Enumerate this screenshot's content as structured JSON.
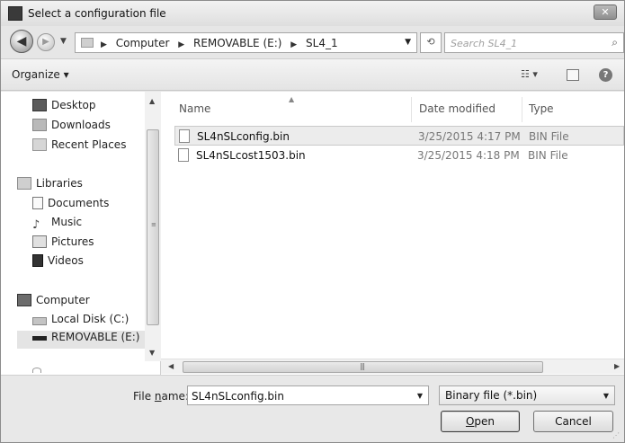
{
  "window": {
    "title": "Select a configuration file",
    "close_label": "✕"
  },
  "nav": {
    "back_icon": "◀",
    "forward_icon": "▶",
    "recent_icon": "▼"
  },
  "address": {
    "breadcrumbs": [
      "Computer",
      "REMOVABLE (E:)",
      "SL4_1"
    ],
    "separator": "▶",
    "dropdown_icon": "▼",
    "refresh_icon": "⟲"
  },
  "search": {
    "placeholder": "Search SL4_1",
    "icon": "⌕"
  },
  "toolbar": {
    "organize_label": "Organize ▾",
    "view_label": "☷ ▾",
    "help_label": "?"
  },
  "sidebar": {
    "items": [
      {
        "label": "Desktop",
        "icon": "desktop-icon"
      },
      {
        "label": "Downloads",
        "icon": "downloads-icon"
      },
      {
        "label": "Recent Places",
        "icon": "recent-places-icon"
      },
      {
        "label": "Libraries",
        "icon": "libraries-icon"
      },
      {
        "label": "Documents",
        "icon": "documents-icon"
      },
      {
        "label": "Music",
        "icon": "music-icon"
      },
      {
        "label": "Pictures",
        "icon": "pictures-icon"
      },
      {
        "label": "Videos",
        "icon": "videos-icon"
      },
      {
        "label": "Computer",
        "icon": "computer-icon"
      },
      {
        "label": "Local Disk (C:)",
        "icon": "local-disk-icon"
      },
      {
        "label": "REMOVABLE (E:)",
        "icon": "removable-drive-icon"
      }
    ],
    "music_glyph": "♪"
  },
  "files": {
    "columns": [
      "Name",
      "Date modified",
      "Type"
    ],
    "sort_icon": "▲",
    "rows": [
      {
        "name": "SL4nSLconfig.bin",
        "date": "3/25/2015 4:17 PM",
        "type": "BIN File"
      },
      {
        "name": "SL4nSLcost1503.bin",
        "date": "3/25/2015 4:18 PM",
        "type": "BIN File"
      }
    ]
  },
  "scroll": {
    "up": "▲",
    "down": "▼",
    "left": "◀",
    "right": "▶",
    "vgrip": "≡",
    "hgrip": "|||"
  },
  "bottom": {
    "filename_label_pre": "File ",
    "filename_label_mnemonic": "n",
    "filename_label_post": "ame:",
    "filename_value": "SL4nSLconfig.bin",
    "filter_value": "Binary file (*.bin)",
    "dropdown_icon": "▼",
    "open_mnemonic": "O",
    "open_rest": "pen",
    "cancel_label": "Cancel",
    "corner_grip": "⋰"
  }
}
